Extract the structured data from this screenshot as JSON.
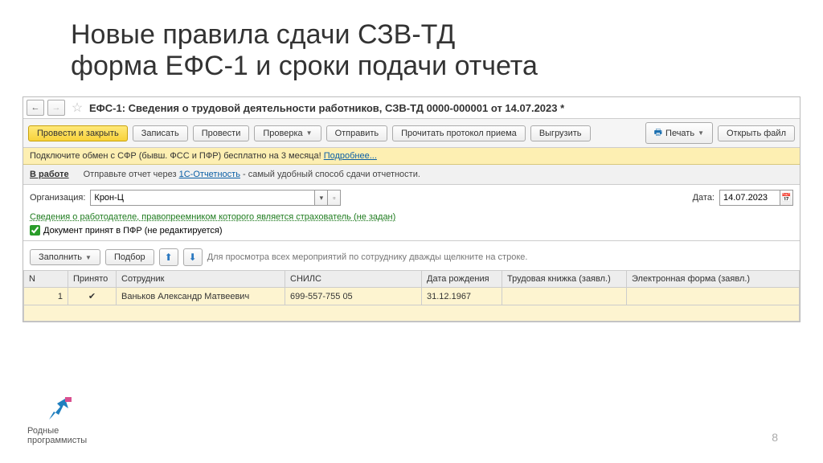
{
  "slide": {
    "title_line1": "Новые правила сдачи СЗВ-ТД",
    "title_line2": "форма ЕФС-1 и сроки подачи отчета",
    "page_number": "8",
    "logo_line1": "Родные",
    "logo_line2": "программисты"
  },
  "nav": {
    "doc_title": "ЕФС-1: Сведения о трудовой деятельности работников, СЗВ-ТД 0000-000001 от 14.07.2023 *"
  },
  "toolbar": {
    "post_close": "Провести и закрыть",
    "write": "Записать",
    "post": "Провести",
    "check": "Проверка",
    "send": "Отправить",
    "read_proto": "Прочитать протокол приема",
    "export": "Выгрузить",
    "print": "Печать",
    "open_file": "Открыть файл"
  },
  "banner": {
    "text": "Подключите обмен с СФР (бывш. ФСС и ПФР) бесплатно на 3 месяца! ",
    "link": "Подробнее..."
  },
  "status": {
    "state": "В работе",
    "text1": "Отправьте отчет через ",
    "link": "1С-Отчетность",
    "text2": " - самый удобный способ сдачи отчетности."
  },
  "form": {
    "org_label": "Организация:",
    "org_value": "Крон-Ц",
    "date_label": "Дата:",
    "date_value": "14.07.2023",
    "employer_link": "Сведения о работодателе, правопреемником которого является страхователь (не задан)",
    "doc_accepted": "Документ принят в ПФР (не редактируется)"
  },
  "actions": {
    "fill": "Заполнить",
    "pick": "Подбор",
    "hint": "Для просмотра всех мероприятий по сотруднику дважды щелкните на строке."
  },
  "table": {
    "headers": {
      "n": "N",
      "accepted": "Принято",
      "employee": "Сотрудник",
      "snils": "СНИЛС",
      "birthdate": "Дата рождения",
      "workbook": "Трудовая книжка (заявл.)",
      "eform": "Электронная форма (заявл.)"
    },
    "row": {
      "n": "1",
      "employee": "Ваньков Александр Матвеевич",
      "snils": "699-557-755 05",
      "birthdate": "31.12.1967"
    }
  }
}
